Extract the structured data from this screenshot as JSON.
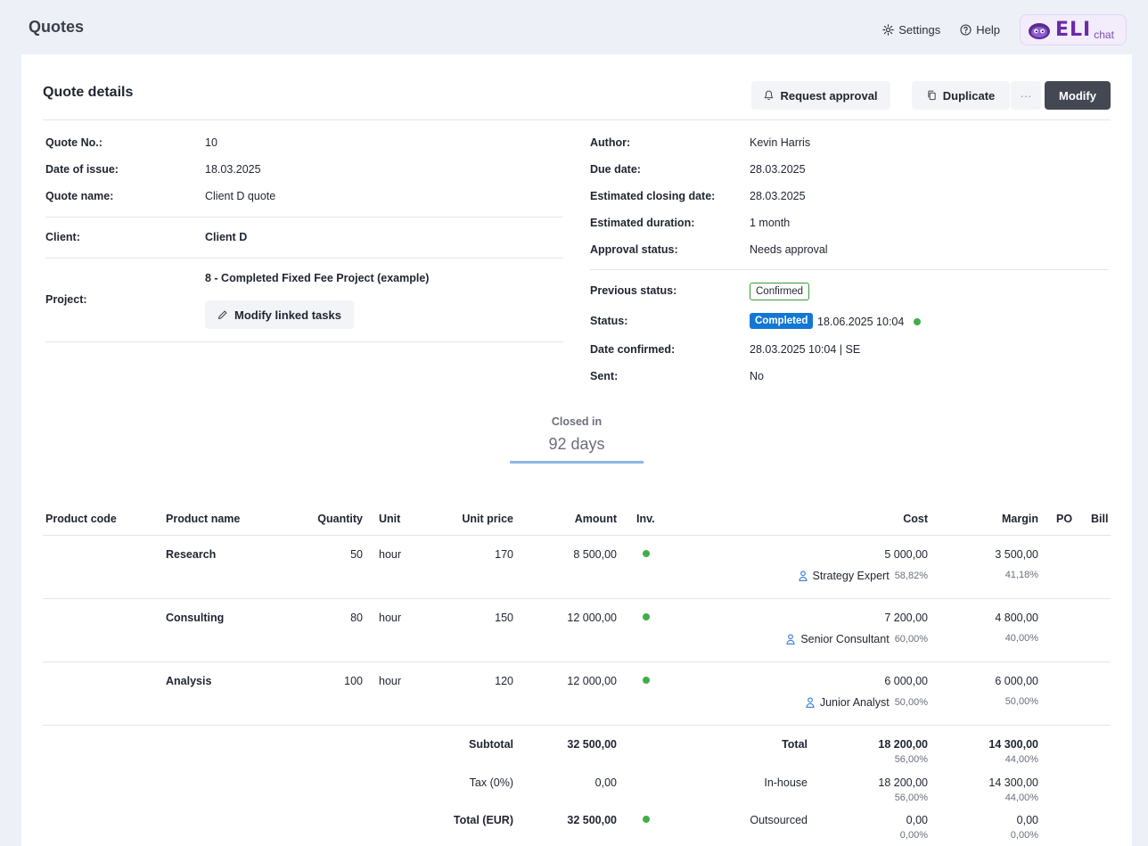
{
  "app": {
    "title": "Quotes",
    "settings_label": "Settings",
    "help_label": "Help",
    "eli_brand": "ELI",
    "eli_sub": "chat"
  },
  "colors": {
    "accent": "#1477d4",
    "dark_button": "#434852",
    "success": "#3fae49"
  },
  "card": {
    "title": "Quote details",
    "request_approval_label": "Request approval",
    "duplicate_label": "Duplicate",
    "more_label": "···",
    "modify_label": "Modify"
  },
  "left_fields": {
    "quote_no_label": "Quote No.:",
    "quote_no": "10",
    "date_issue_label": "Date of issue:",
    "date_issue": "18.03.2025",
    "quote_name_label": "Quote name:",
    "quote_name": "Client D quote",
    "client_label": "Client:",
    "client": "Client D",
    "project_label": "Project:",
    "project": "8 - Completed Fixed Fee Project (example)",
    "modify_tasks_label": "Modify linked tasks"
  },
  "right_fields": {
    "author_label": "Author:",
    "author": "Kevin Harris",
    "due_label": "Due date:",
    "due": "28.03.2025",
    "est_close_label": "Estimated closing date:",
    "est_close": "28.03.2025",
    "est_dur_label": "Estimated duration:",
    "est_dur": "1 month",
    "approval_label": "Approval status:",
    "approval": "Needs approval",
    "prev_status_label": "Previous status:",
    "prev_status": "Confirmed",
    "status_label": "Status:",
    "status": "Completed",
    "status_time": "18.06.2025 10:04",
    "date_confirmed_label": "Date confirmed:",
    "date_confirmed": "28.03.2025 10:04 | SE",
    "sent_label": "Sent:",
    "sent": "No"
  },
  "closed": {
    "label": "Closed in",
    "value": "92 days"
  },
  "table": {
    "headers": {
      "code": "Product code",
      "name": "Product name",
      "qty": "Quantity",
      "unit": "Unit",
      "price": "Unit price",
      "amount": "Amount",
      "inv": "Inv.",
      "cost": "Cost",
      "margin": "Margin",
      "po": "PO",
      "bill": "Bill"
    },
    "rows": [
      {
        "name": "Research",
        "qty": "50",
        "unit": "hour",
        "price": "170",
        "amount": "8 500,00",
        "cost": "5 000,00",
        "margin": "3 500,00",
        "assignee": "Strategy Expert",
        "cost_pct": "58,82%",
        "margin_pct": "41,18%"
      },
      {
        "name": "Consulting",
        "qty": "80",
        "unit": "hour",
        "price": "150",
        "amount": "12 000,00",
        "cost": "7 200,00",
        "margin": "4 800,00",
        "assignee": "Senior Consultant",
        "cost_pct": "60,00%",
        "margin_pct": "40,00%"
      },
      {
        "name": "Analysis",
        "qty": "100",
        "unit": "hour",
        "price": "120",
        "amount": "12 000,00",
        "cost": "6 000,00",
        "margin": "6 000,00",
        "assignee": "Junior Analyst",
        "cost_pct": "50,00%",
        "margin_pct": "50,00%"
      }
    ]
  },
  "totals": {
    "subtotal_label": "Subtotal",
    "subtotal": "32 500,00",
    "tax_label": "Tax (0%)",
    "tax": "0,00",
    "total_eur_label": "Total (EUR)",
    "total_eur": "32 500,00",
    "total_label": "Total",
    "total_cost": "18 200,00",
    "total_cost_pct": "56,00%",
    "total_margin": "14 300,00",
    "total_margin_pct": "44,00%",
    "inhouse_label": "In-house",
    "inhouse_cost": "18 200,00",
    "inhouse_cost_pct": "56,00%",
    "inhouse_margin": "14 300,00",
    "inhouse_margin_pct": "44,00%",
    "outsourced_label": "Outsourced",
    "out_cost": "0,00",
    "out_cost_pct": "0,00%",
    "out_margin": "0,00",
    "out_margin_pct": "0,00%"
  }
}
